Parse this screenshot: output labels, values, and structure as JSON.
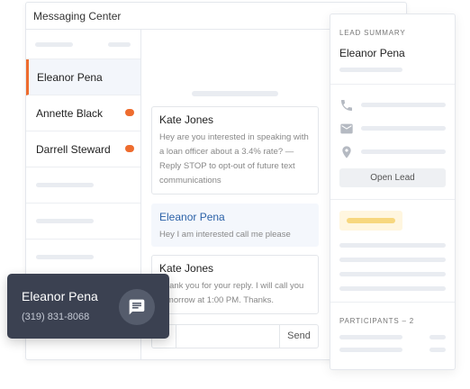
{
  "window": {
    "title": "Messaging Center"
  },
  "contacts": [
    {
      "name": "Eleanor Pena",
      "active": true,
      "unread": false
    },
    {
      "name": "Annette Black",
      "active": false,
      "unread": true
    },
    {
      "name": "Darrell Steward",
      "active": false,
      "unread": true
    }
  ],
  "messages": [
    {
      "sender": "Kate Jones",
      "text": "Hey are you interested in speaking with a loan officer about a 3.4% rate? — Reply STOP to opt-out of future text communications",
      "direction": "outbound"
    },
    {
      "sender": "Eleanor Pena",
      "text": "Hey I am interested call me please",
      "direction": "inbound"
    },
    {
      "sender": "Kate Jones",
      "text": "Thank you for your reply. I will call you tomorrow at 1:00 PM. Thanks.",
      "direction": "outbound"
    }
  ],
  "composer": {
    "value": "",
    "placeholder": "",
    "send_label": "Send"
  },
  "summary": {
    "section_label": "LEAD SUMMARY",
    "name": "Eleanor Pena",
    "open_button": "Open Lead",
    "participants_label": "PARTICIPANTS – 2",
    "icons": [
      "phone-icon",
      "email-icon",
      "location-pin-icon"
    ]
  },
  "popup": {
    "name": "Eleanor Pena",
    "phone": "(319) 831-8068",
    "icon": "chat-icon"
  },
  "colors": {
    "accent": "#ee6c2e",
    "inbound_sender": "#2c62a8",
    "popup_bg": "#3b4151",
    "highlight": "#f7d77e"
  }
}
